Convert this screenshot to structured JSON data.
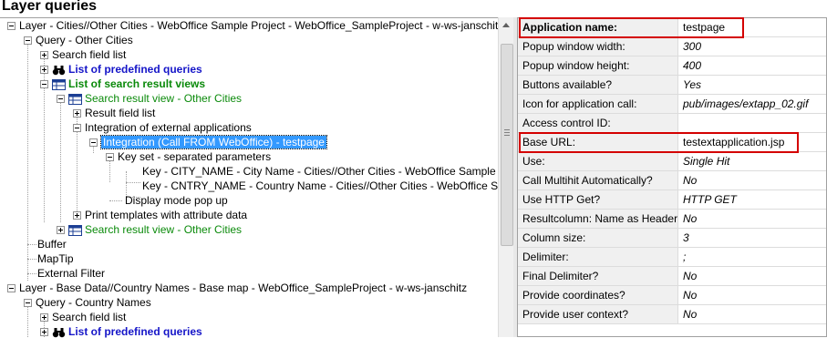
{
  "header": {
    "title": "Layer queries"
  },
  "tree": {
    "n1": "Layer - Cities//Other Cities - WebOffice Sample Project - WebOffice_SampleProject - w-ws-janschitz",
    "n2": "Query - Other Cities",
    "n3": "Search field list",
    "n4": "List of predefined queries",
    "n5": "List of search result views",
    "n6": "Search result view - Other Cities",
    "n7": "Result field list",
    "n8": "Integration of external applications",
    "n9": "Integration (Call FROM WebOffice) - testpage",
    "n10": "Key set - separated parameters",
    "n11": "Key - CITY_NAME - City Name - Cities//Other Cities - WebOffice Sample Proj",
    "n12": "Key - CNTRY_NAME - Country Name - Cities//Other Cities - WebOffice Sam",
    "n13": "Display mode pop up",
    "n14": "Print templates with attribute data",
    "n15": "Search result view - Other Cities",
    "n16": "Buffer",
    "n17": "MapTip",
    "n18": "External Filter",
    "n19": "Layer - Base Data//Country Names - Base map - WebOffice_SampleProject - w-ws-janschitz",
    "n20": "Query - Country Names",
    "n21": "Search field list",
    "n22": "List of predefined queries"
  },
  "properties": [
    {
      "name": "Application name:",
      "value": "testpage"
    },
    {
      "name": "Popup window width:",
      "value": "300"
    },
    {
      "name": "Popup window height:",
      "value": "400"
    },
    {
      "name": "Buttons available?",
      "value": "Yes"
    },
    {
      "name": "Icon for application call:",
      "value": "pub/images/extapp_02.gif"
    },
    {
      "name": "Access control ID:",
      "value": ""
    },
    {
      "name": "Base URL:",
      "value": "testextapplication.jsp"
    },
    {
      "name": "Use:",
      "value": "Single Hit"
    },
    {
      "name": "Call Multihit Automatically?",
      "value": "No"
    },
    {
      "name": "Use HTTP Get?",
      "value": "HTTP GET"
    },
    {
      "name": "Resultcolumn: Name as Header?",
      "value": "No"
    },
    {
      "name": "Column size:",
      "value": "3"
    },
    {
      "name": "Delimiter:",
      "value": ";"
    },
    {
      "name": "Final Delimiter?",
      "value": "No"
    },
    {
      "name": "Provide coordinates?",
      "value": "No"
    },
    {
      "name": "Provide user context?",
      "value": "No"
    }
  ],
  "colors": {
    "selection": "#3399ff",
    "highlight_box": "#d40000",
    "link_blue": "#1515c8",
    "green": "#0a8a0a"
  }
}
